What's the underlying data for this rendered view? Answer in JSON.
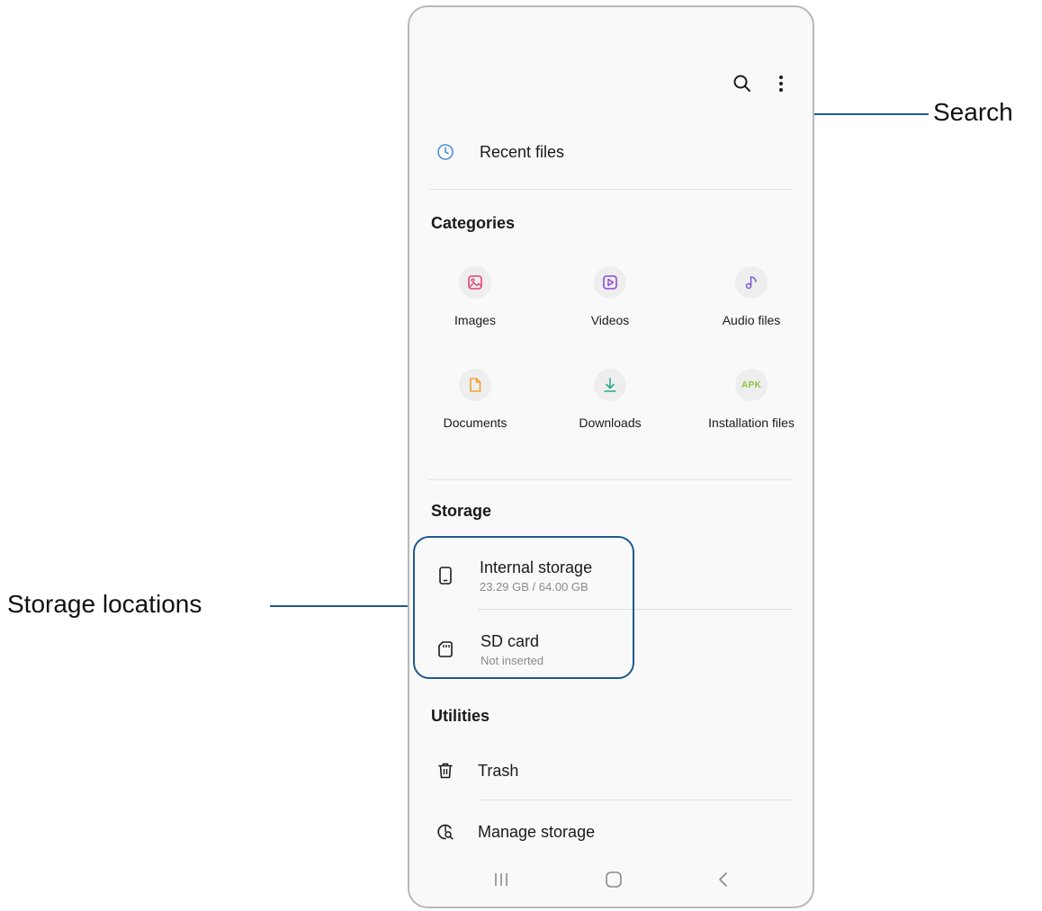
{
  "header": {
    "search_icon": "search-icon",
    "more_icon": "more-vertical-icon"
  },
  "recent": {
    "label": "Recent files",
    "icon": "clock-icon"
  },
  "categories": {
    "title": "Categories",
    "items": [
      {
        "label": "Images",
        "icon": "image-icon",
        "color": "#e0457b"
      },
      {
        "label": "Videos",
        "icon": "play-icon",
        "color": "#8a4bd4"
      },
      {
        "label": "Audio files",
        "icon": "music-note-icon",
        "color": "#7a55d6"
      },
      {
        "label": "Documents",
        "icon": "document-icon",
        "color": "#f0a030"
      },
      {
        "label": "Downloads",
        "icon": "download-icon",
        "color": "#2aa98e"
      },
      {
        "label": "Installation files",
        "icon": "apk-icon",
        "color": "#8cc63f",
        "badge": "APK"
      }
    ]
  },
  "storage": {
    "title": "Storage",
    "items": [
      {
        "title": "Internal storage",
        "subtitle": "23.29 GB / 64.00 GB",
        "icon": "phone-icon"
      },
      {
        "title": "SD card",
        "subtitle": "Not inserted",
        "icon": "sd-card-icon"
      }
    ]
  },
  "utilities": {
    "title": "Utilities",
    "items": [
      {
        "label": "Trash",
        "icon": "trash-icon"
      },
      {
        "label": "Manage storage",
        "icon": "manage-storage-icon"
      }
    ]
  },
  "navbar": {
    "recents_icon": "recents-icon",
    "home_icon": "home-icon",
    "back_icon": "back-icon"
  },
  "annotations": {
    "search": "Search",
    "storage_locations": "Storage locations",
    "callout_color": "#1d5a8e"
  }
}
